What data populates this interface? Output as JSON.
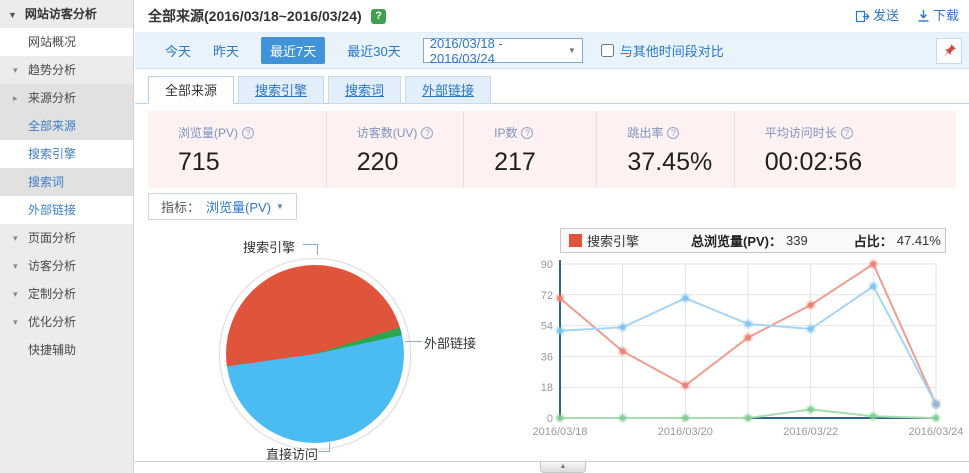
{
  "sidebar": {
    "title": "网站访客分析",
    "items": [
      {
        "label": "网站概况"
      },
      {
        "label": "趋势分析"
      },
      {
        "label": "来源分析"
      },
      {
        "label": "全部来源"
      },
      {
        "label": "搜索引擎"
      },
      {
        "label": "搜索词"
      },
      {
        "label": "外部链接"
      },
      {
        "label": "页面分析"
      },
      {
        "label": "访客分析"
      },
      {
        "label": "定制分析"
      },
      {
        "label": "优化分析"
      },
      {
        "label": "快捷辅助"
      }
    ]
  },
  "header": {
    "title": "全部来源(2016/03/18~2016/03/24)",
    "help": "?",
    "send": "发送",
    "download": "下载"
  },
  "filters": {
    "today": "今天",
    "yesterday": "昨天",
    "last7days": "最近7天",
    "last30days": "最近30天",
    "date_range": "2016/03/18 - 2016/03/24",
    "compare": "与其他时间段对比"
  },
  "tabs": [
    {
      "label": "全部来源"
    },
    {
      "label": "搜索引擎"
    },
    {
      "label": "搜索词"
    },
    {
      "label": "外部链接"
    }
  ],
  "metrics": [
    {
      "label": "浏览量(PV)",
      "value": "715"
    },
    {
      "label": "访客数(UV)",
      "value": "220"
    },
    {
      "label": "IP数",
      "value": "217"
    },
    {
      "label": "跳出率",
      "value": "37.45%"
    },
    {
      "label": "平均访问时长",
      "value": "00:02:56"
    }
  ],
  "indicator": {
    "label": "指标：",
    "value": "浏览量(PV)"
  },
  "legend": {
    "series": "搜索引擎",
    "color": "#e0543c",
    "total_label": "总浏览量(PV)：",
    "total_value": "339",
    "share_label": "占比：",
    "share_value": "47.41%"
  },
  "icons": {
    "sidebar_collapse": "▼",
    "branch_open": "▾",
    "branch_closed": "▸",
    "date_caret": "▼",
    "indicator_caret": "▼",
    "help": "?"
  },
  "bottom": {
    "collapse": "▲"
  },
  "chart_data": [
    {
      "type": "pie",
      "start_angle": 262,
      "slices": [
        {
          "label": "搜索引擎",
          "value": 47.41,
          "color": "#e0543c"
        },
        {
          "label": "外部链接",
          "value": 1.4,
          "color": "#2aa84f"
        },
        {
          "label": "直接访问",
          "value": 51.19,
          "color": "#4abcf1"
        }
      ]
    },
    {
      "type": "line",
      "x": [
        "2016/03/18",
        "2016/03/19",
        "2016/03/20",
        "2016/03/21",
        "2016/03/22",
        "2016/03/23",
        "2016/03/24"
      ],
      "x_tick_labels": [
        {
          "i": 0,
          "text": "2016/03/18"
        },
        {
          "i": 2,
          "text": "2016/03/20"
        },
        {
          "i": 4,
          "text": "2016/03/22"
        },
        {
          "i": 6,
          "text": "2016/03/24"
        }
      ],
      "ylim": [
        0,
        90
      ],
      "yticks": [
        0,
        18,
        36,
        54,
        72,
        90
      ],
      "grid": true,
      "axis_color": "#2e6586",
      "series": [
        {
          "name": "搜索引擎",
          "color": "#ef9d92",
          "marker": "#e87f70",
          "values": [
            70,
            39,
            19,
            47,
            66,
            90,
            8
          ]
        },
        {
          "name": "直接访问",
          "color": "#a6d5f5",
          "marker": "#7cc2ef",
          "values": [
            51,
            53,
            70,
            55,
            52,
            77,
            8
          ]
        },
        {
          "name": "外部链接",
          "color": "#a9dcb3",
          "marker": "#7ecc8e",
          "values": [
            0,
            0,
            0,
            0,
            5,
            1,
            0
          ]
        }
      ]
    }
  ]
}
